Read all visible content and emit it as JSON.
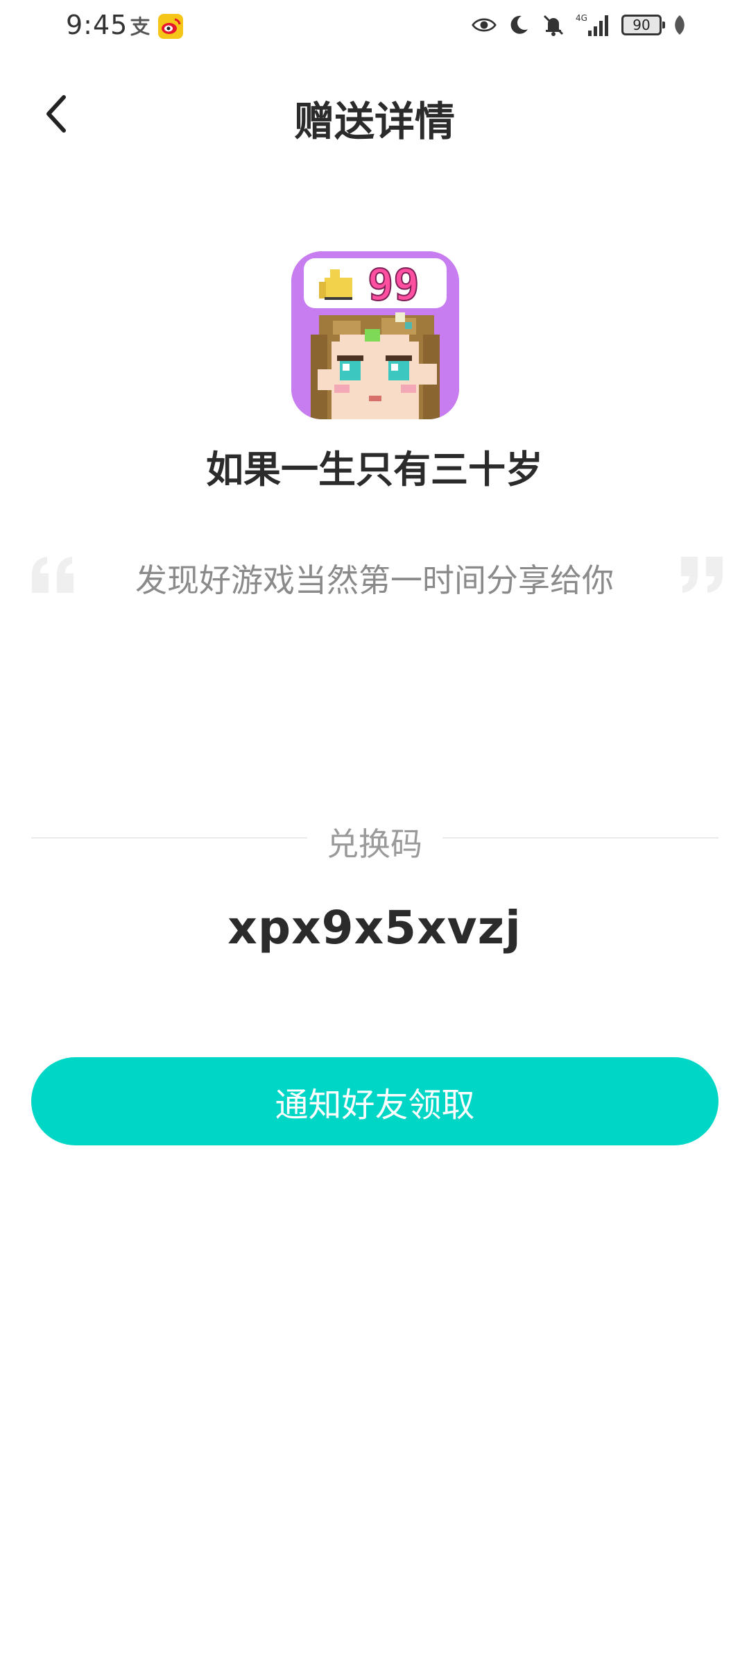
{
  "status_bar": {
    "time": "9:45",
    "battery": "90",
    "network": "4G"
  },
  "header": {
    "title": "赠送详情"
  },
  "game": {
    "name": "如果一生只有三十岁",
    "icon_badge": "99"
  },
  "quote": {
    "text": "发现好游戏当然第一时间分享给你"
  },
  "redeem": {
    "label": "兑换码",
    "code": "xpx9x5xvzj"
  },
  "actions": {
    "notify_label": "通知好友领取"
  },
  "colors": {
    "accent": "#00d6c6",
    "text_primary": "#2b2b2b",
    "text_secondary": "#8a8a8a",
    "icon_bg": "#c77cf0"
  }
}
